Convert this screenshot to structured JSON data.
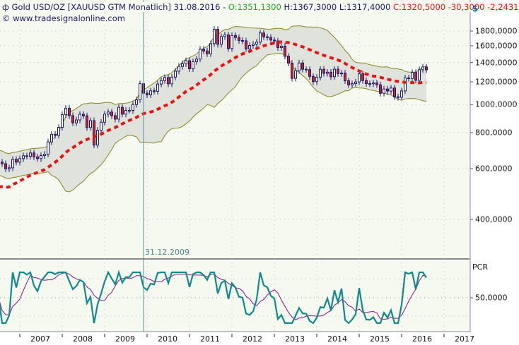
{
  "header": {
    "icon": "instrument-icon",
    "instrument": "Gold USD/OZ [XAUUSD GTM  Monatlich]",
    "date": "31.08.2016",
    "dash": "-",
    "open": "O:1351,1300",
    "high": "H:1367,3000",
    "low": "L:1317,4000",
    "close": "C:1320,5000 -30,3000 -2,2431%",
    "copyright": "© www.tradesignalonline.com"
  },
  "currency": "$",
  "marker_label": "31.12.2009",
  "indicator_label": "PCR",
  "indicator_tick": "50,0000",
  "colors": {
    "background": "#f6f9ef",
    "candle_outline": "#1a1a6a",
    "down": "#e01818",
    "up": "#ffffff",
    "band_fill": "#e0e2dc",
    "band_edge": "#86861e",
    "ma": "#ee1111",
    "pcr": "#108a8a",
    "pcr_signal": "#8a108a",
    "marker": "#4a9a9a"
  },
  "chart_data": {
    "type": "candlestick",
    "title": "Gold USD/OZ [XAUUSD GTM  Monatlich]",
    "scale": "log",
    "ylim": [
      300,
      2000
    ],
    "yticks": [
      {
        "v": 1800,
        "label": "1800,0000"
      },
      {
        "v": 1600,
        "label": "1600,0000"
      },
      {
        "v": 1400,
        "label": "1400,0000"
      },
      {
        "v": 1200,
        "label": "1200,0000"
      },
      {
        "v": 1000,
        "label": "1000,0000"
      },
      {
        "v": 800,
        "label": "800,0000"
      },
      {
        "v": 600,
        "label": "600,0000"
      },
      {
        "v": 400,
        "label": "400,0000"
      }
    ],
    "xticks": [
      "2007",
      "2008",
      "2009",
      "2010",
      "2011",
      "2012",
      "2013",
      "2014",
      "2015",
      "2016",
      "2017"
    ],
    "start": "2006-07",
    "close": [
      632,
      624,
      599,
      604,
      646,
      632,
      650,
      665,
      662,
      680,
      659,
      650,
      666,
      673,
      743,
      789,
      783,
      834,
      923,
      972,
      916,
      865,
      885,
      926,
      915,
      833,
      880,
      724,
      815,
      869,
      927,
      943,
      916,
      891,
      979,
      927,
      955,
      955,
      1001,
      1040,
      1182,
      1096,
      1081,
      1117,
      1113,
      1179,
      1212,
      1242,
      1181,
      1246,
      1307,
      1357,
      1386,
      1421,
      1332,
      1410,
      1439,
      1556,
      1536,
      1500,
      1628,
      1826,
      1620,
      1722,
      1746,
      1566,
      1737,
      1710,
      1669,
      1664,
      1561,
      1604,
      1622,
      1648,
      1773,
      1719,
      1711,
      1675,
      1664,
      1578,
      1595,
      1472,
      1393,
      1234,
      1312,
      1395,
      1327,
      1323,
      1253,
      1202,
      1244,
      1326,
      1284,
      1296,
      1250,
      1327,
      1282,
      1287,
      1210,
      1172,
      1183,
      1199,
      1279,
      1212,
      1183,
      1182,
      1190,
      1172,
      1095,
      1133,
      1115,
      1142,
      1065,
      1061,
      1116,
      1238,
      1233,
      1293,
      1215,
      1322,
      1351,
      1320.5
    ],
    "overlays": [
      "Bollinger Bands",
      "Moving Average (red dashed)"
    ],
    "indicator": {
      "name": "PCR",
      "reference": 50
    }
  }
}
